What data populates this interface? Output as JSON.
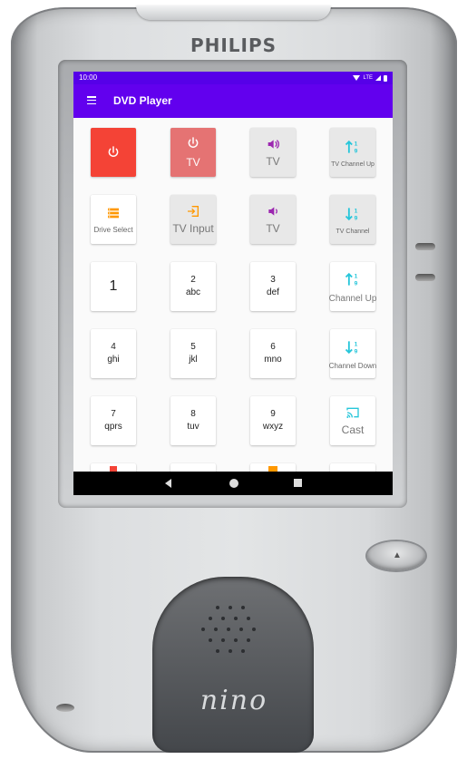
{
  "device": {
    "brand": "PHILIPS",
    "logo": "nino",
    "body_color": "#dcdee0"
  },
  "status_bar": {
    "time": "10:00",
    "network": "LTE",
    "icons": [
      "wifi-icon",
      "signal-icon",
      "battery-icon"
    ]
  },
  "app_bar": {
    "title": "DVD Player",
    "menu_icon": "menu-icon",
    "color": "#6200ee"
  },
  "buttons": [
    {
      "id": "power",
      "label": "",
      "icon": "power-icon",
      "style": "red"
    },
    {
      "id": "tv-power",
      "label": "TV",
      "icon": "power-icon",
      "style": "pink"
    },
    {
      "id": "tv-volume-up",
      "label": "TV",
      "icon": "volume-up-icon",
      "style": "gray"
    },
    {
      "id": "tv-channel-up",
      "label": "TV Channel Up",
      "icon": "sort-ascending-icon",
      "style": "gray"
    },
    {
      "id": "drive-select",
      "label": "Drive Select",
      "icon": "list-icon",
      "style": "white"
    },
    {
      "id": "tv-input",
      "label": "TV Input",
      "icon": "input-icon",
      "style": "gray"
    },
    {
      "id": "tv-volume-down",
      "label": "TV",
      "icon": "volume-down-icon",
      "style": "gray"
    },
    {
      "id": "tv-channel-down",
      "label": "TV Channel",
      "icon": "sort-descending-icon",
      "style": "gray"
    },
    {
      "id": "key-1",
      "digit": "1",
      "letters": ""
    },
    {
      "id": "key-2",
      "digit": "2",
      "letters": "abc"
    },
    {
      "id": "key-3",
      "digit": "3",
      "letters": "def"
    },
    {
      "id": "channel-up",
      "label": "Channel Up",
      "icon": "sort-ascending-icon",
      "style": "white"
    },
    {
      "id": "key-4",
      "digit": "4",
      "letters": "ghi"
    },
    {
      "id": "key-5",
      "digit": "5",
      "letters": "jkl"
    },
    {
      "id": "key-6",
      "digit": "6",
      "letters": "mno"
    },
    {
      "id": "channel-down",
      "label": "Channel Down",
      "icon": "sort-descending-icon",
      "style": "white"
    },
    {
      "id": "key-7",
      "digit": "7",
      "letters": "qprs"
    },
    {
      "id": "key-8",
      "digit": "8",
      "letters": "tuv"
    },
    {
      "id": "key-9",
      "digit": "9",
      "letters": "wxyz"
    },
    {
      "id": "cast",
      "label": "Cast",
      "icon": "cast-icon",
      "style": "white"
    }
  ],
  "colors": {
    "power_red": "#f44336",
    "tv_power_pink": "#e57373",
    "volume_purple": "#9c27b0",
    "channel_cyan": "#26c6da",
    "accent_orange": "#ff9800"
  },
  "nav_bar": {
    "back": "back-icon",
    "home": "home-icon",
    "recents": "recents-icon"
  }
}
